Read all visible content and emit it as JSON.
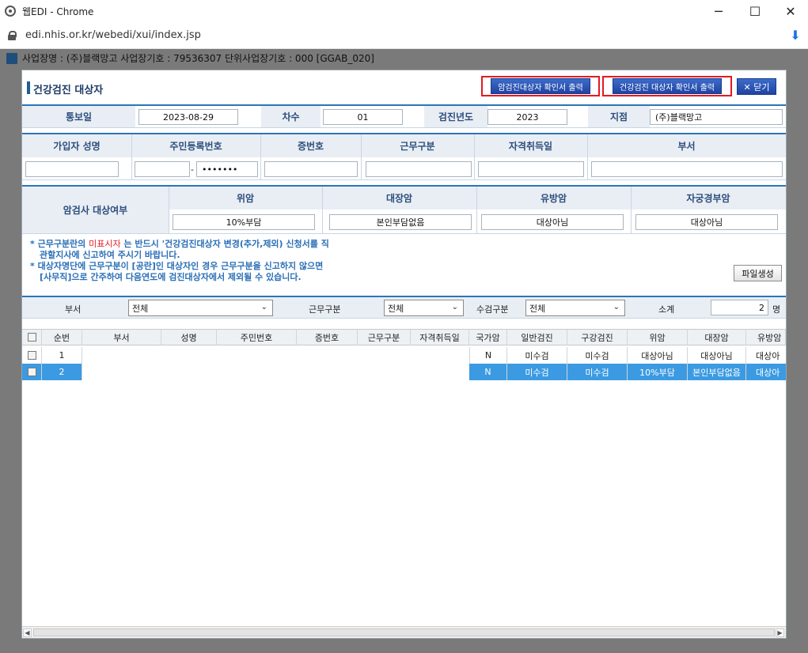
{
  "window": {
    "title": "웹EDI - Chrome",
    "url": "edi.nhis.or.kr/webedi/xui/index.jsp",
    "min_icon": "─",
    "max_icon": "☐",
    "close_icon": "✕",
    "download_icon": "⬇"
  },
  "page": {
    "biz_info": "사업장명 : (주)블랙망고 사업장기호 : 79536307 단위사업장기호 : 000 [GGAB_020]"
  },
  "modal": {
    "title": "건강검진 대상자",
    "buttons": {
      "cancer_print": "암검진대상자 확인서 출력",
      "health_print": "건강검진 대상자 확인서 출력",
      "close": "✕ 닫기"
    },
    "row1": {
      "notice_date_label": "통보일",
      "notice_date_value": "2023-08-29",
      "round_label": "차수",
      "round_value": "01",
      "year_label": "검진년도",
      "year_value": "2023",
      "branch_label": "지점",
      "branch_value": "(주)블랙망고"
    },
    "row2": {
      "name_label": "가입자 성명",
      "rrn_label": "주민등록번호",
      "rrn_back": "•••••••",
      "rrn_dash": "-",
      "card_label": "증번호",
      "work_label": "근무구분",
      "qual_label": "자격취득일",
      "dept_label": "부서"
    },
    "row3": {
      "cancer_label": "암검사 대상여부",
      "stomach_label": "위암",
      "stomach_value": "10%부담",
      "colon_label": "대장암",
      "colon_value": "본인부담없음",
      "breast_label": "유방암",
      "breast_value": "대상아님",
      "cervix_label": "자궁경부암",
      "cervix_value": "대상아님"
    },
    "notice": {
      "line1_pre": "* 근무구분란의 ",
      "line1_red": "미표시자",
      "line1_post": " 는 반드시 '건강검진대상자 변경(추가,제외) 신청서를 직",
      "line2": "  관할지사에 신고하여 주시기 바랍니다.",
      "line3": "* 대상자명단에 근무구분이 [공란]인 대상자인 경우 근무구분을 신고하지 않으면",
      "line4": "  [사무직]으로 간주하여 다음연도에 검진대상자에서 제외될 수 있습니다."
    },
    "file_button": "파일생성",
    "filter": {
      "dept_label": "부서",
      "dept_value": "전체",
      "work_label": "근무구분",
      "work_value": "전체",
      "exam_label": "수검구분",
      "exam_value": "전체",
      "subtotal_label": "소계",
      "subtotal_value": "2",
      "unit": "명",
      "chevron": "⌄"
    },
    "grid": {
      "headers": [
        "순번",
        "부서",
        "성명",
        "주민번호",
        "증번호",
        "근무구분",
        "자격취득일",
        "국가암",
        "일반검진",
        "구강검진",
        "위암",
        "대장암",
        "유방암"
      ],
      "rows": [
        {
          "no": "1",
          "national": "N",
          "general": "미수검",
          "oral": "미수검",
          "stomach": "대상아님",
          "colon": "대상아님",
          "breast": "대상아"
        },
        {
          "no": "2",
          "national": "N",
          "general": "미수검",
          "oral": "미수검",
          "stomach": "10%부담",
          "colon": "본인부담없음",
          "breast": "대상아"
        }
      ]
    },
    "scroll": {
      "left": "◀",
      "right": "▶"
    }
  }
}
